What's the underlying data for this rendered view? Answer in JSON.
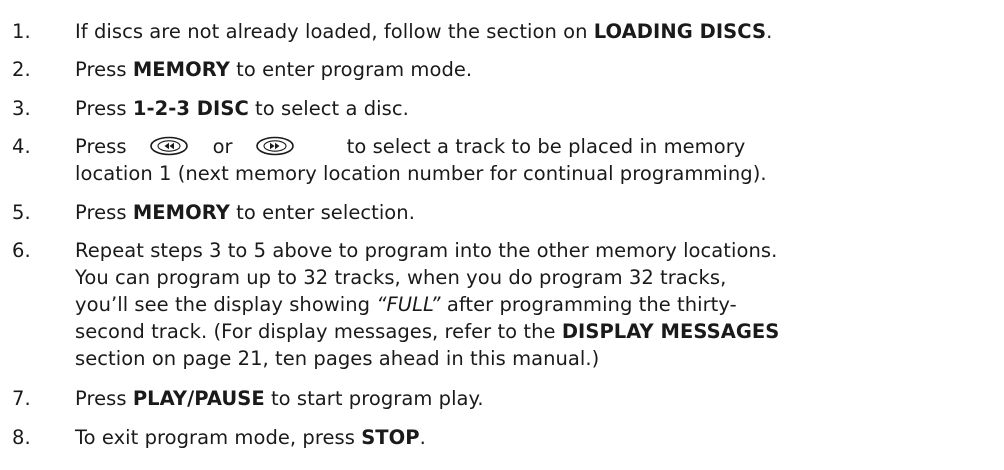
{
  "steps": [
    {
      "num": "1.",
      "t1": "If discs are not already loaded, follow the section on ",
      "b1": "LOADING DISCS",
      "t2": "."
    },
    {
      "num": "2.",
      "t1": "Press ",
      "b1": "MEMORY",
      "t2": " to enter program mode."
    },
    {
      "num": "3.",
      "t1": "Press ",
      "b1": "1-2-3 DISC",
      "t2": " to select a disc."
    },
    {
      "num": "4.",
      "t1": "Press",
      "t2": "or",
      "t3": "to select a track to be placed in memory",
      "line2": "location 1 (next memory location number for continual programming).",
      "icon_prev": "skip-back-icon",
      "icon_next": "skip-forward-icon"
    },
    {
      "num": "5.",
      "t1": "Press ",
      "b1": "MEMORY",
      "t2": " to enter selection."
    },
    {
      "num": "6.",
      "line1": "Repeat steps 3 to 5 above to program into the other memory locations.",
      "line2": "You can program up to 32 tracks, when you do program 32 tracks,",
      "line3_a": "you’ll see the display showing ",
      "line3_i": "“FULL”",
      "line3_b": " after programming the thirty-",
      "line4_a": "second track. (For display messages, refer to the ",
      "line4_b": "DISPLAY MESSAGES",
      "line5": "section on page 21, ten pages ahead in this manual.)"
    },
    {
      "num": "7.",
      "t1": "Press ",
      "b1": "PLAY/PAUSE",
      "t2": " to start program play."
    },
    {
      "num": "8.",
      "t1": "To exit program mode, press ",
      "b1": "STOP",
      "t2": "."
    }
  ]
}
